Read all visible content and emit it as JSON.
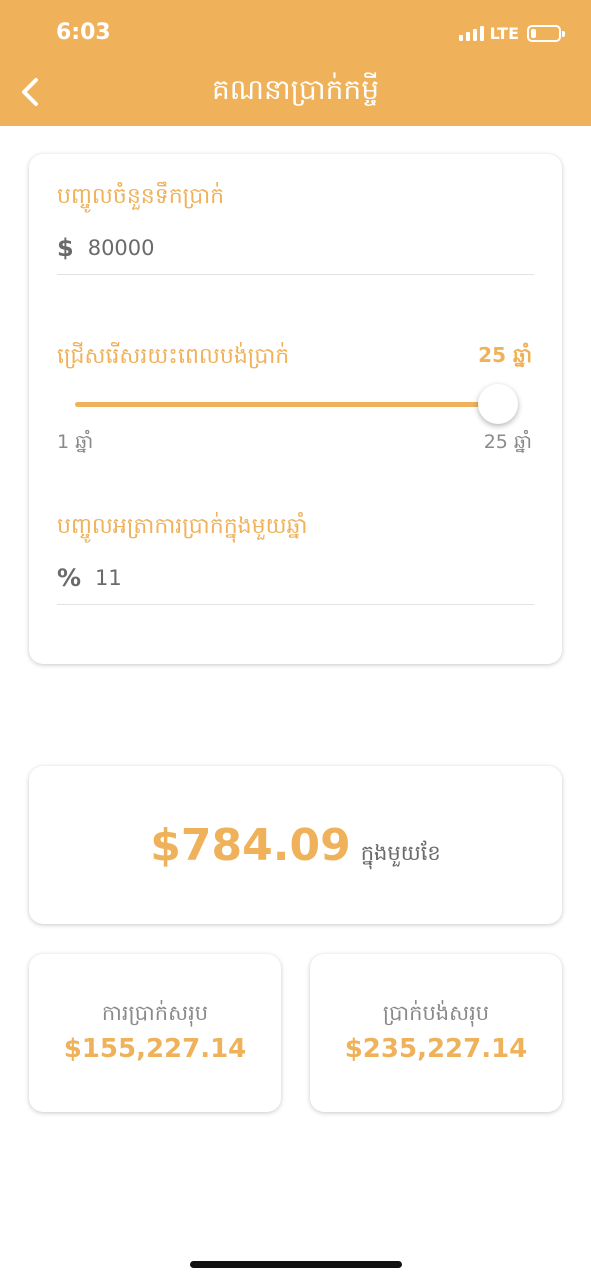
{
  "status_bar": {
    "time": "6:03",
    "network": "LTE"
  },
  "header": {
    "title": "គណនាប្រាក់កម្ចី",
    "back_icon": "chevron-left-icon"
  },
  "inputs": {
    "amount": {
      "label": "បញ្ចូលចំនួនទឹកប្រាក់",
      "prefix": "$",
      "value": "80000"
    },
    "term": {
      "label": "ជ្រើសរើសរយះពេលបង់ប្រាក់",
      "value_text": "25 ឆ្នាំ",
      "min_text": "1 ឆ្នាំ",
      "max_text": "25 ឆ្នាំ",
      "min": 1,
      "max": 25,
      "value": 25
    },
    "rate": {
      "label": "បញ្ចូលអត្រាការប្រាក់ក្នុងមួយឆ្នាំ",
      "prefix": "%",
      "value": "11"
    }
  },
  "results": {
    "monthly_amount": "$784.09",
    "monthly_unit": "ក្នុងមួយខែ",
    "total_interest_label": "ការប្រាក់សរុប",
    "total_interest_value": "$155,227.14",
    "total_payment_label": "ប្រាក់បង់សរុប",
    "total_payment_value": "$235,227.14"
  },
  "colors": {
    "accent": "#EFB25A",
    "text": "#6a6a6a"
  }
}
